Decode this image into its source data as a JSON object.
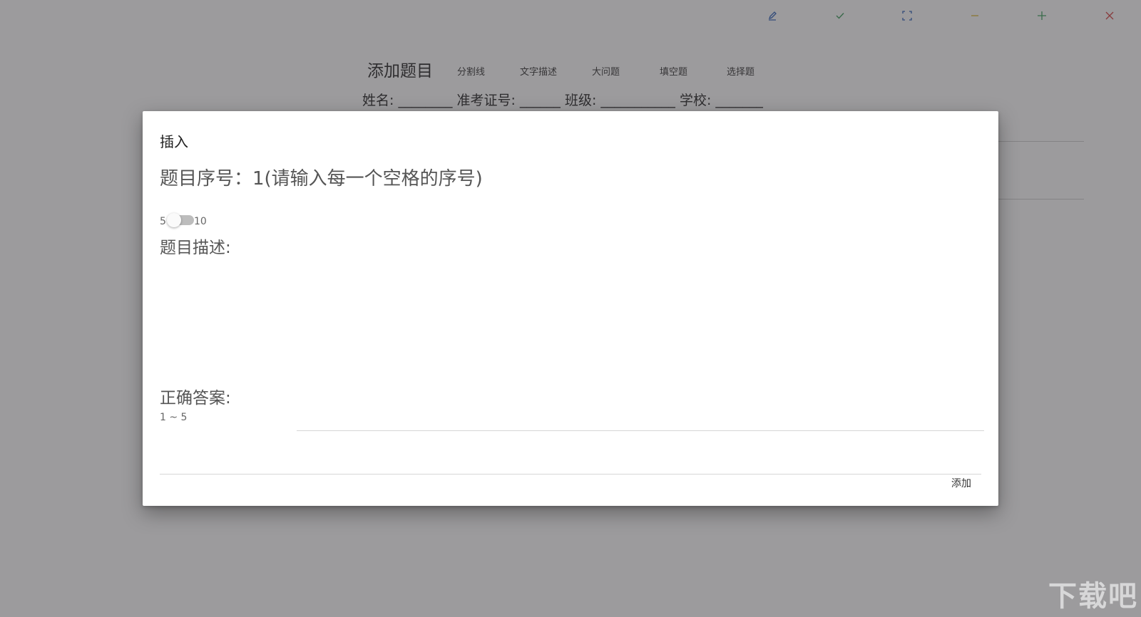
{
  "window_controls": {
    "edit_icon_color": "#2b5fb8",
    "check_icon_color": "#3a9a5a",
    "fullscreen_icon_color": "#2b5fb8",
    "minimize_icon_color": "#d8b52a",
    "maximize_icon_color": "#3aa05a",
    "close_icon_color": "#d64040"
  },
  "toolbar": {
    "title": "添加题目",
    "items": [
      "分割线",
      "文字描述",
      "大问题",
      "填空题",
      "选择题"
    ]
  },
  "student_info": "姓名: ________ 准考证号: ______ 班级: ___________ 学校: _______",
  "dialog": {
    "title": "插入",
    "question_number_label": "题目序号：1(请输入每一个空格的序号)",
    "switch": {
      "min_label": "5",
      "max_label": "10",
      "on": false
    },
    "description_label": "题目描述:",
    "description_value": "",
    "answer_label": "正确答案:",
    "answer_range": "1 ~ 5",
    "answer_value": "",
    "add_button": "添加"
  },
  "watermark": "下载吧"
}
